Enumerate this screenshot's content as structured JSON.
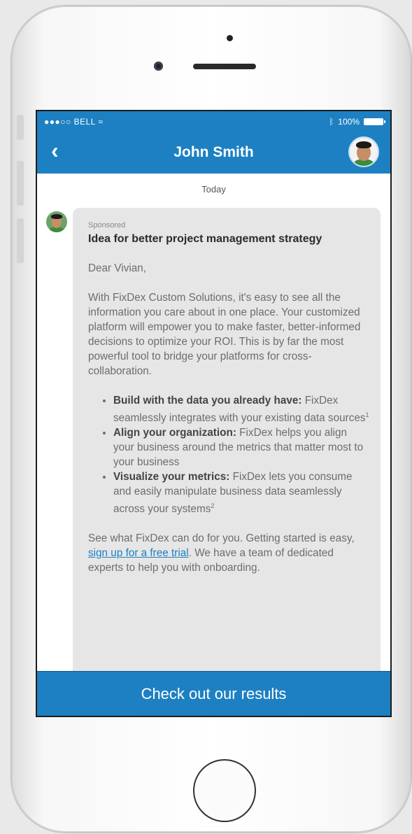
{
  "status_bar": {
    "signal": "●●●○○",
    "carrier": "BELL",
    "wifi": "≈",
    "bluetooth": "ᛒ",
    "battery": "100%"
  },
  "header": {
    "back_icon": "chevron-left-icon",
    "back_glyph": "‹",
    "title": "John Smith",
    "avatar": "profile-avatar"
  },
  "conversation": {
    "date_label": "Today"
  },
  "message": {
    "sponsored_label": "Sponsored",
    "subject": "Idea for better project management strategy",
    "greeting": "Dear Vivian,",
    "body": "With FixDex Custom Solutions, it's easy to see all the information you care about in one place. Your customized platform will empower you to make faster, better-informed decisions to optimize your ROI. This is by far the most powerful tool to bridge your platforms for cross-collaboration.",
    "bullets": [
      {
        "title": "Build with the data you already have:",
        "text": " FixDex seamlessly integrates with your existing data sources",
        "note": "1"
      },
      {
        "title": "Align your organization:",
        "text": " FixDex helps you align your business around the metrics that matter most to your business",
        "note": ""
      },
      {
        "title": "Visualize your metrics:",
        "text": " FixDex lets you consume and easily manipulate business data seamlessly across your systems",
        "note": "2"
      }
    ],
    "closing_prefix": "See what FixDex can do for you.  Getting started is easy, ",
    "closing_link": "sign up for a free trial",
    "closing_suffix": ". We have a team of dedicated experts to help you with onboarding."
  },
  "cta": {
    "label": "Check out our results"
  },
  "colors": {
    "accent": "#1d80c2",
    "bubble": "#e6e6e6"
  }
}
